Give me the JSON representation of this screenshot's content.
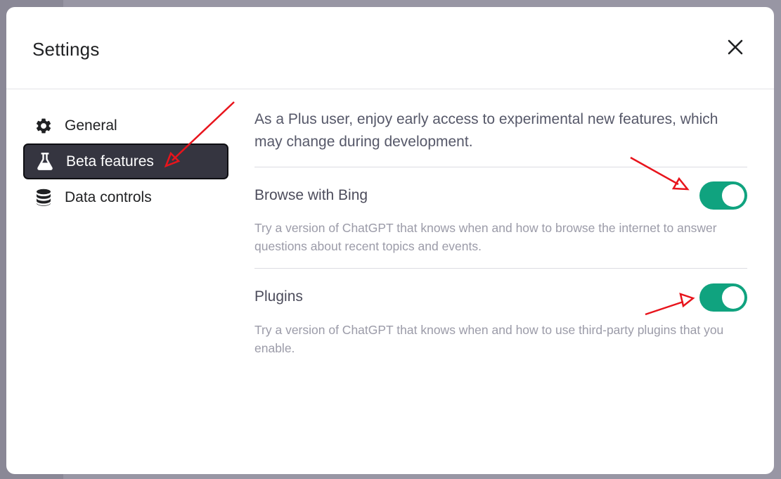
{
  "modal": {
    "title": "Settings",
    "close_icon": "close-icon"
  },
  "sidebar": {
    "items": [
      {
        "label": "General",
        "icon": "gear-icon",
        "active": false
      },
      {
        "label": "Beta features",
        "icon": "flask-icon",
        "active": true
      },
      {
        "label": "Data controls",
        "icon": "database-icon",
        "active": false
      }
    ]
  },
  "content": {
    "intro": "As a Plus user, enjoy early access to experimental new features, which may change during development.",
    "features": [
      {
        "title": "Browse with Bing",
        "description": "Try a version of ChatGPT that knows when and how to browse the internet to answer questions about recent topics and events.",
        "enabled": true
      },
      {
        "title": "Plugins",
        "description": "Try a version of ChatGPT that knows when and how to use third-party plugins that you enable.",
        "enabled": true
      }
    ]
  },
  "colors": {
    "toggle_on": "#10a37f",
    "active_nav_bg": "#353540",
    "annotation_arrow": "#e8141c"
  }
}
